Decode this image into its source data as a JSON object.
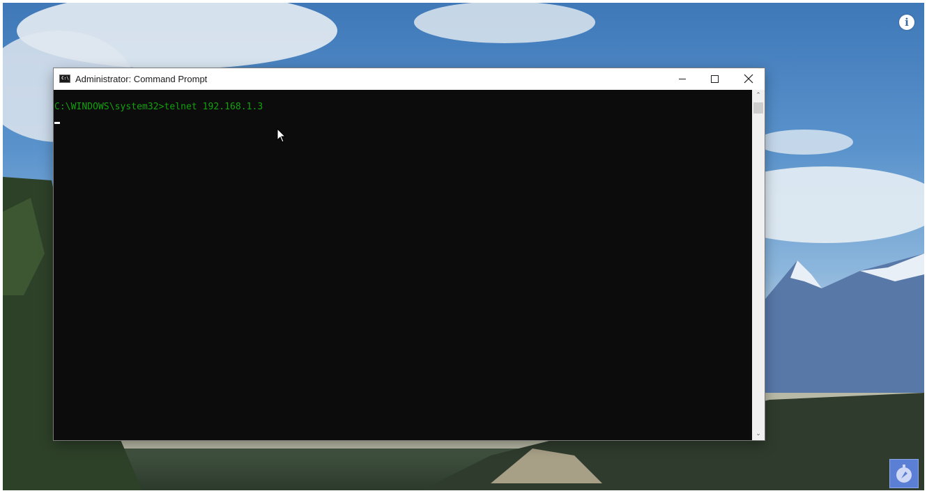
{
  "desktop": {
    "info_icon": "info-icon",
    "info_glyph": "i",
    "corner_widget_icon": "compass-icon"
  },
  "window": {
    "title": "Administrator: Command Prompt",
    "icon": "cmd-icon",
    "icon_glyph": "C:\\",
    "controls": {
      "minimize_icon": "minimize-icon",
      "maximize_icon": "maximize-icon",
      "close_icon": "close-icon"
    }
  },
  "console": {
    "prompt_line": "C:\\WINDOWS\\system32>telnet 192.168.1.3",
    "text_color": "#13a10e",
    "background": "#0c0c0c"
  },
  "scrollbar": {
    "up_glyph": "⌃",
    "down_glyph": "⌄"
  }
}
